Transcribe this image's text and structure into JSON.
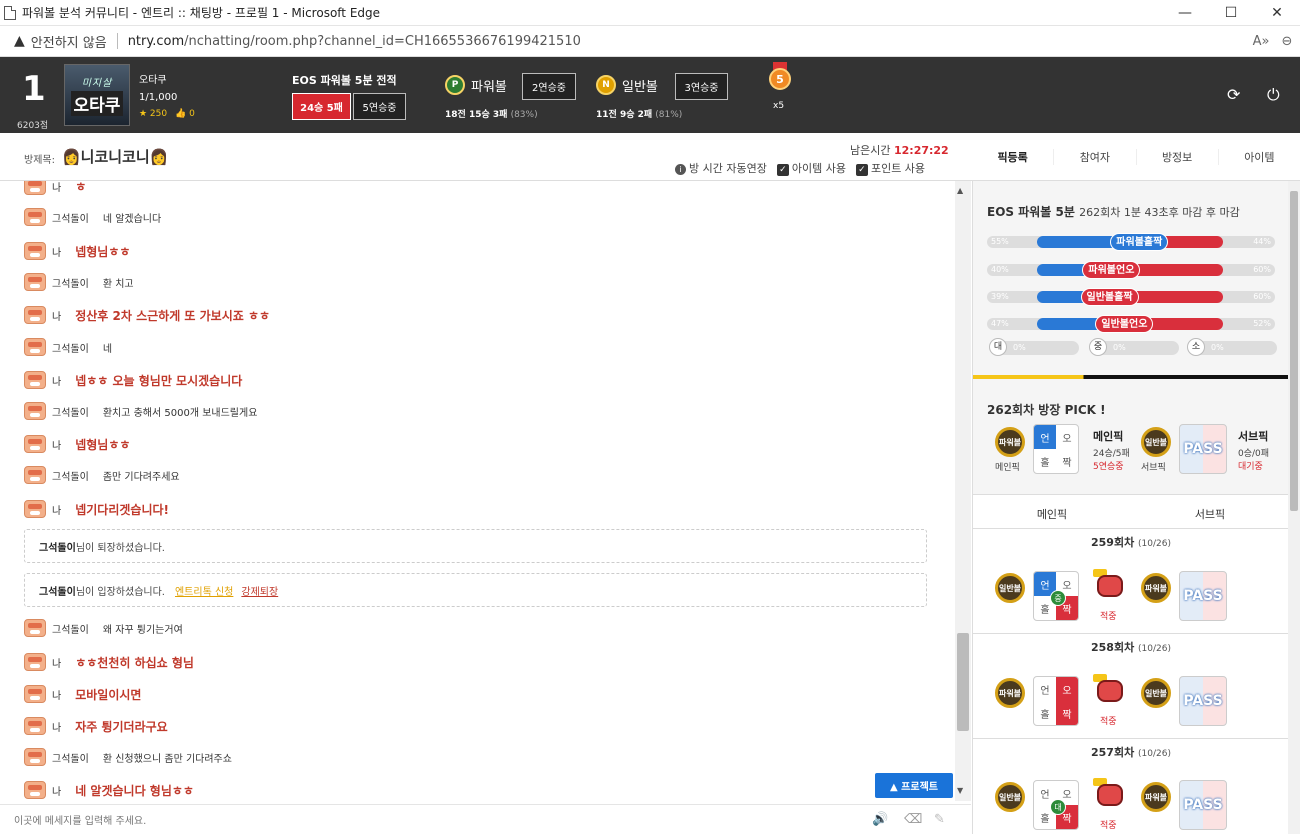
{
  "window": {
    "title": "파워볼 분석 커뮤니티 - 엔트리 :: 채팅방 - 프로필 1 - Microsoft Edge",
    "minimize": "—",
    "maximize": "☐",
    "close": "✕"
  },
  "address": {
    "insecure_label": "안전하지 않음",
    "url_host": "ntry.com",
    "url_path": "/nchatting/room.php?channel_id=CH1665536676199421510"
  },
  "header": {
    "rank": "1",
    "score": "6203점",
    "avatar_top": "미지살",
    "avatar_bottom": "오타쿠",
    "user_name": "오타쿠",
    "user_level": "1/1,000",
    "stars": "★ 250",
    "likes": "👍 0",
    "eos_title": "EOS 파워볼 5분 전적",
    "eos_record": "24승 5패",
    "eos_streak": "5연승중",
    "powerball_label": "파워볼",
    "powerball_ball": "P",
    "powerball_streak": "2연승중",
    "powerball_record": "18전 15승 3패",
    "powerball_pct": "(83%)",
    "normal_label": "일반볼",
    "normal_ball": "N",
    "normal_streak": "3연승중",
    "normal_record": "11전 9승 2패",
    "normal_pct": "(81%)",
    "medal_num": "5",
    "medal_count": "x5"
  },
  "room": {
    "label": "방제목:",
    "title": "👩니코니코니👩",
    "timer_label": "남은시간",
    "timer_value": "12:27:22",
    "opt_extend": "방 시간 자동연장",
    "opt_item": "아이템 사용",
    "opt_point": "포인트 사용",
    "tabs": [
      "픽등록",
      "참여자",
      "방정보",
      "아이템"
    ]
  },
  "chat": {
    "messages": [
      {
        "who": "나",
        "text": "ㅎ",
        "me": true
      },
      {
        "who": "그석돌이",
        "text": "네 알겠습니다",
        "me": false
      },
      {
        "who": "나",
        "text": "넵형님ㅎㅎ",
        "me": true
      },
      {
        "who": "그석돌이",
        "text": "환 치고",
        "me": false
      },
      {
        "who": "나",
        "text": "정산후 2차 스근하게 또 가보시죠 ㅎㅎ",
        "me": true
      },
      {
        "who": "그석돌이",
        "text": "네",
        "me": false
      },
      {
        "who": "나",
        "text": "넵ㅎㅎ 오늘 형님만 모시겠습니다",
        "me": true
      },
      {
        "who": "그석돌이",
        "text": "환치고 충해서 5000개 보내드릴게요",
        "me": false
      },
      {
        "who": "나",
        "text": "넵형님ㅎㅎ",
        "me": true
      },
      {
        "who": "그석돌이",
        "text": "좀만 기다려주세요",
        "me": false
      },
      {
        "who": "나",
        "text": "넵기다리겟습니다!",
        "me": true
      },
      {
        "who": "그석돌이",
        "text": "왜 자꾸 튕기는거여",
        "me": false
      },
      {
        "who": "나",
        "text": "ㅎㅎ천천히 하십쇼 형님",
        "me": true
      },
      {
        "who": "나",
        "text": "모바일이시면",
        "me": true
      },
      {
        "who": "나",
        "text": "자주 튕기더라구요",
        "me": true
      },
      {
        "who": "그석돌이",
        "text": "환 신청했으니 좀만 기다려주쇼",
        "me": false
      },
      {
        "who": "나",
        "text": "네 알겟습니다 형님ㅎㅎ",
        "me": true
      }
    ],
    "sys_leave_name": "그석돌이",
    "sys_leave_text": "님이 퇴장하셨습니다.",
    "sys_enter_name": "그석돌이",
    "sys_enter_text": "님이 입장하셨습니다.",
    "sys_enter_link1": "엔트리톡 신청",
    "sys_enter_link2": "강제퇴장",
    "protect_label": "▲ 프로젝트",
    "input_placeholder": "이곳에 메세지를 입력해 주세요."
  },
  "panel": {
    "game_name": "EOS 파워볼 5분",
    "game_round": "262회차 1분 43초후 마감 후 마감",
    "bars": [
      {
        "label": "파워볼홀짝",
        "left": "55%",
        "right": "44%",
        "left_value": 55,
        "lbl_color": "#2a79d6"
      },
      {
        "label": "파워볼언오",
        "left": "40%",
        "right": "60%",
        "left_value": 40,
        "lbl_color": "#d92f3c"
      },
      {
        "label": "일반볼홀짝",
        "left": "39%",
        "right": "60%",
        "left_value": 39,
        "lbl_color": "#d92f3c"
      },
      {
        "label": "일반볼언오",
        "left": "47%",
        "right": "52%",
        "left_value": 47,
        "lbl_color": "#d92f3c"
      }
    ],
    "mini": [
      {
        "icon": "대",
        "pct": "0%"
      },
      {
        "icon": "중",
        "pct": "0%"
      },
      {
        "icon": "소",
        "pct": "0%"
      }
    ],
    "pick_title": "262회차 방장 PICK !",
    "main_ball": "파워볼",
    "main_label": "메인픽",
    "main_grid": [
      "언",
      "오",
      "홀",
      "짝"
    ],
    "main_title": "메인픽",
    "main_record": "24승/5패",
    "main_streak": "5연승중",
    "sub_ball": "일반볼",
    "sub_label": "서브픽",
    "pass_label": "PASS",
    "sub_title": "서브픽",
    "sub_record": "0승/0패",
    "sub_status": "대기중",
    "hist_tabs": [
      "메인픽",
      "서브픽"
    ],
    "rounds": [
      {
        "title": "259회차",
        "date": "(10/26)",
        "ball1": "일반볼",
        "ball2": "파워볼",
        "hit": "적중",
        "circle": "중"
      },
      {
        "title": "258회차",
        "date": "(10/26)",
        "ball1": "파워볼",
        "ball2": "일반볼",
        "hit": "적중",
        "circle": ""
      },
      {
        "title": "257회차",
        "date": "(10/26)",
        "ball1": "일반볼",
        "ball2": "파워볼",
        "hit": "적중",
        "circle": "대"
      }
    ]
  }
}
